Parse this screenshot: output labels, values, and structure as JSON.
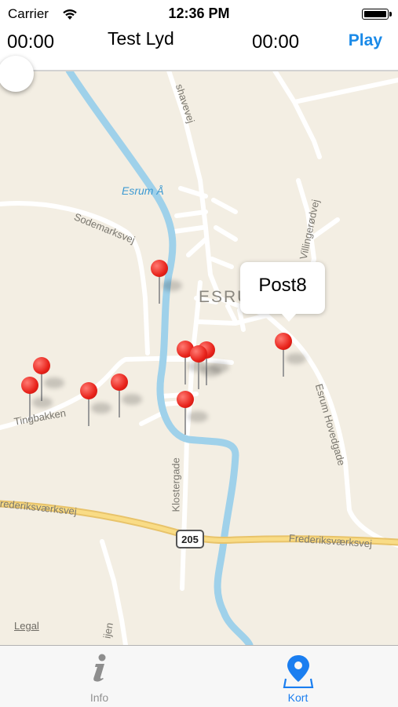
{
  "status_bar": {
    "carrier": "Carrier",
    "time": "12:36 PM"
  },
  "player": {
    "elapsed": "00:00",
    "title": "Test Lyd",
    "duration": "00:00",
    "play_label": "Play",
    "progress": 0
  },
  "map": {
    "town_label": "ESRU",
    "river_label": "Esrum Å",
    "roads": {
      "sodemarksvej": "Sodemarksvej",
      "tingbakken": "Tingbakken",
      "klostergade": "Klostergade",
      "villingerodvej": "Villingerødvej",
      "esrum_hovedgade": "Esrum Hovedgade",
      "frederiksvaerksvej_left": "rederiksværksvej",
      "frederiksvaerksvej_right": "Frederiksværksvej",
      "shavevej": "shavevej",
      "bottom_road": "ijen"
    },
    "route_number": "205",
    "legal": "Legal",
    "callout": "Post8"
  },
  "tabbar": {
    "info_label": "Info",
    "kort_label": "Kort"
  },
  "colors": {
    "accent": "#1a7ef0",
    "pin": "#e8231b",
    "river": "#9fd1ea",
    "highway": "#f5cf6b"
  }
}
